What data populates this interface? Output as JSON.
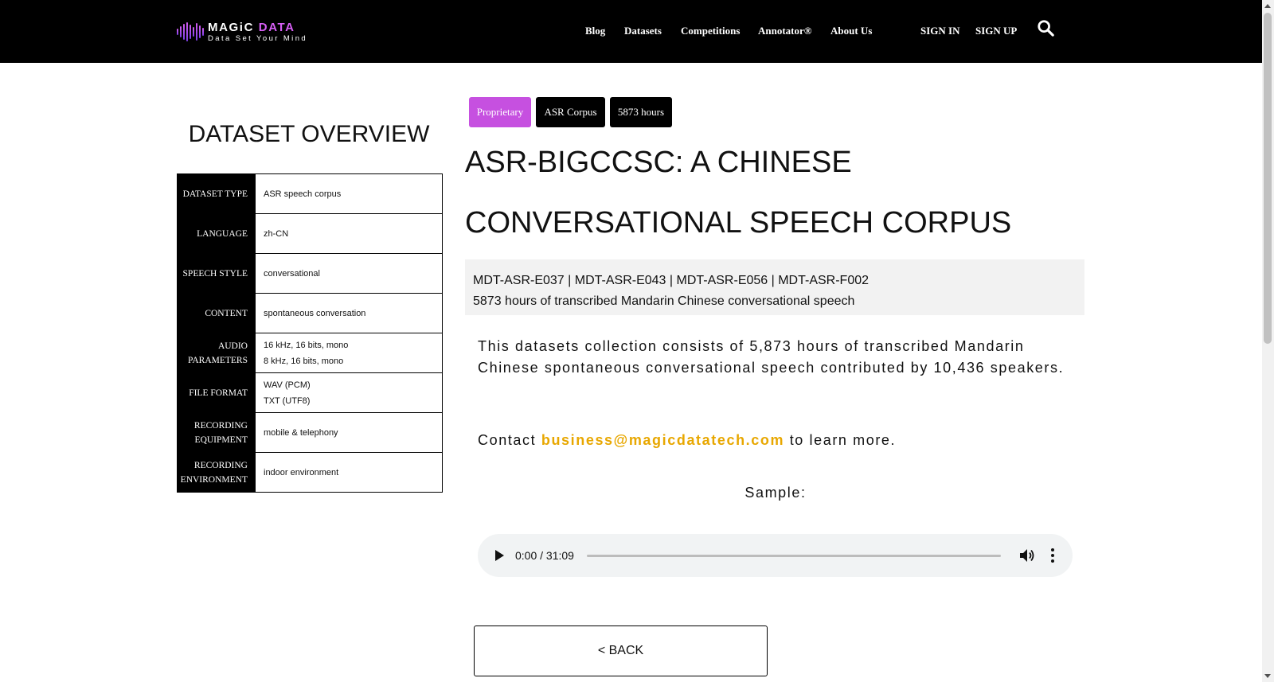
{
  "header": {
    "logo": {
      "main_prefix": "MAGiC ",
      "main_accent": "DATA",
      "tagline": "Data Set Your Mind"
    },
    "nav": [
      {
        "label": "Blog"
      },
      {
        "label": "Datasets"
      },
      {
        "label": "Competitions"
      },
      {
        "label": "Annotator®"
      },
      {
        "label": "About Us"
      }
    ],
    "sign_in": "SIGN IN",
    "sign_up": "SIGN UP"
  },
  "overview": {
    "title": "DATASET OVERVIEW",
    "rows": [
      {
        "label": "DATASET TYPE",
        "values": [
          "ASR speech corpus"
        ]
      },
      {
        "label": "LANGUAGE",
        "values": [
          "zh-CN"
        ]
      },
      {
        "label": "SPEECH STYLE",
        "values": [
          "conversational"
        ]
      },
      {
        "label": "CONTENT",
        "values": [
          "spontaneous conversation"
        ]
      },
      {
        "label": "AUDIO PARAMETERS",
        "values": [
          "16 kHz, 16 bits, mono",
          "8 kHz, 16 bits, mono"
        ]
      },
      {
        "label": "FILE FORMAT",
        "values": [
          "WAV (PCM)",
          "TXT (UTF8)"
        ]
      },
      {
        "label": "RECORDING EQUIPMENT",
        "values": [
          "mobile & telephony"
        ]
      },
      {
        "label": "RECORDING ENVIRONMENT",
        "values": [
          "indoor environment"
        ]
      }
    ]
  },
  "tags": [
    "Proprietary",
    "ASR Corpus",
    "5873 hours"
  ],
  "main": {
    "title": "ASR-BIGCCSC: A CHINESE CONVERSATIONAL SPEECH CORPUS",
    "ids": "MDT-ASR-E037 | MDT-ASR-E043 | MDT-ASR-E056 | MDT-ASR-F002",
    "summary": "5873 hours of transcribed Mandarin Chinese conversational speech",
    "description": "This datasets collection consists of 5,873 hours of transcribed Mandarin Chinese spontaneous conversational speech contributed by 10,436 speakers.",
    "contact_prefix": "Contact ",
    "contact_email": "business@magicdatatech.com",
    "contact_suffix": " to learn more.",
    "sample_label": "Sample:",
    "audio_time": "0:00 / 31:09",
    "back_label": "< BACK"
  },
  "colors": {
    "tag_purple": "#c650e0",
    "email": "#e8a700",
    "header_bg": "#000000"
  },
  "icons": [
    "search-icon",
    "play-icon",
    "volume-icon",
    "more-vertical-icon"
  ]
}
